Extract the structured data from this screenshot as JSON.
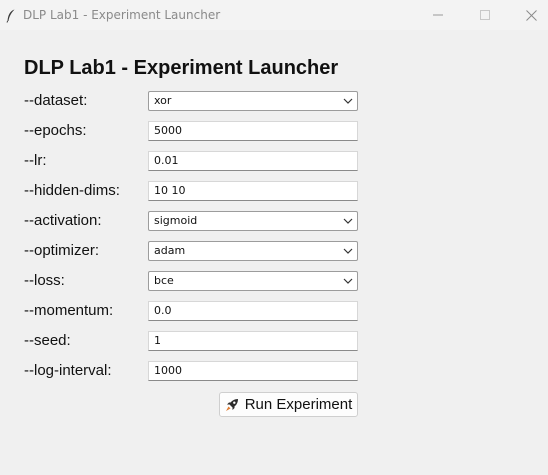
{
  "window": {
    "title": "DLP Lab1 - Experiment Launcher"
  },
  "heading": "DLP Lab1 - Experiment Launcher",
  "fields": {
    "dataset": {
      "label": "--dataset:",
      "value": "xor",
      "type": "select"
    },
    "epochs": {
      "label": "--epochs:",
      "value": "5000",
      "type": "text"
    },
    "lr": {
      "label": "--lr:",
      "value": "0.01",
      "type": "text"
    },
    "hidden_dims": {
      "label": "--hidden-dims:",
      "value": "10 10",
      "type": "text"
    },
    "activation": {
      "label": "--activation:",
      "value": "sigmoid",
      "type": "select"
    },
    "optimizer": {
      "label": "--optimizer:",
      "value": "adam",
      "type": "select"
    },
    "loss": {
      "label": "--loss:",
      "value": "bce",
      "type": "select"
    },
    "momentum": {
      "label": "--momentum:",
      "value": "0.0",
      "type": "text"
    },
    "seed": {
      "label": "--seed:",
      "value": "1",
      "type": "text"
    },
    "log_interval": {
      "label": "--log-interval:",
      "value": "1000",
      "type": "text"
    }
  },
  "run_button": {
    "label": "Run Experiment",
    "icon": "rocket-icon"
  }
}
